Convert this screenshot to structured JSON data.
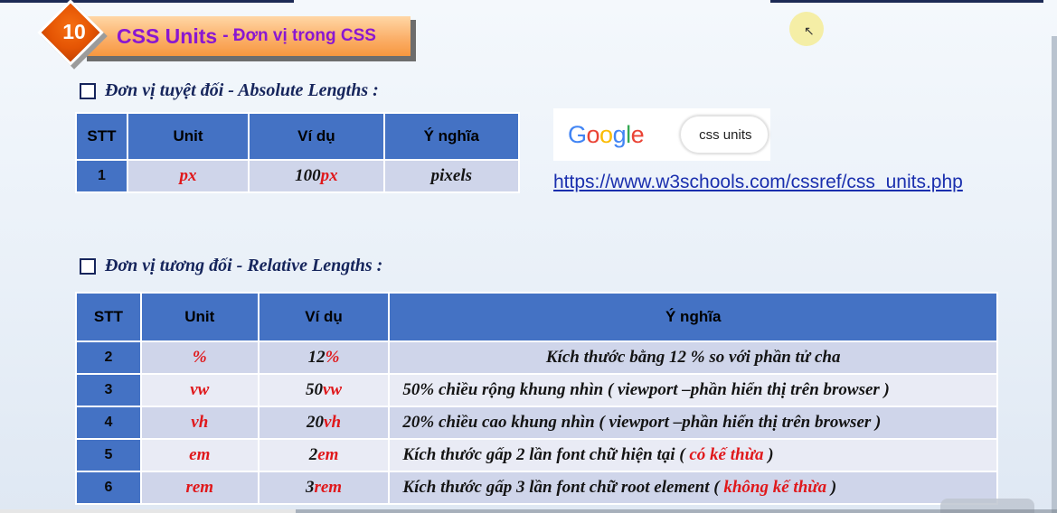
{
  "title": {
    "number": "10",
    "main": "CSS Units",
    "sub": "- Đơn vị trong CSS"
  },
  "absolute": {
    "heading": "Đơn vị tuyệt đối - Absolute Lengths :",
    "headers": [
      "STT",
      "Unit",
      "Ví dụ",
      "Ý nghĩa"
    ],
    "rows": [
      {
        "stt": "1",
        "unit": "px",
        "example_num": "100",
        "example_unit": "px",
        "meaning": "pixels"
      }
    ]
  },
  "google": {
    "logo_letters": [
      "G",
      "o",
      "o",
      "g",
      "l",
      "e"
    ],
    "search_text": "css units",
    "link": "https://www.w3schools.com/cssref/css_units.php"
  },
  "relative": {
    "heading": "Đơn vị tương đối - Relative Lengths :",
    "headers": [
      "STT",
      "Unit",
      "Ví dụ",
      "Ý nghĩa"
    ],
    "rows": [
      {
        "stt": "2",
        "unit": "%",
        "example_num": "12",
        "example_unit": "%",
        "meaning": "Kích thước bằng 12 % so với phần tử cha"
      },
      {
        "stt": "3",
        "unit": "vw",
        "example_num": "50",
        "example_unit": "vw",
        "meaning": "50% chiều rộng khung nhìn ( viewport –phần hiển thị trên browser )"
      },
      {
        "stt": "4",
        "unit": "vh",
        "example_num": "20",
        "example_unit": "vh",
        "meaning": "20% chiều cao khung nhìn ( viewport –phần hiển thị trên browser )"
      },
      {
        "stt": "5",
        "unit": "em",
        "example_num": "2",
        "example_unit": "em",
        "meaning_a": "Kích thước gấp 2 lần font chữ hiện tại (",
        "meaning_b": "có kế thừa",
        "meaning_c": ")"
      },
      {
        "stt": "6",
        "unit": "rem",
        "example_num": "3",
        "example_unit": "rem",
        "meaning_a": "Kích thước gấp 3 lần font chữ root element (",
        "meaning_b": "không kế thừa",
        "meaning_c": ")"
      }
    ]
  },
  "video": {
    "progress_fraction": 0.28
  }
}
